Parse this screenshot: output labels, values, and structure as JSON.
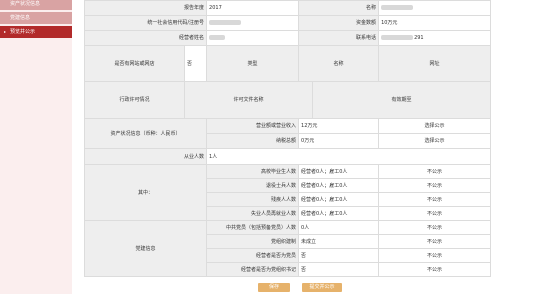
{
  "sidebar": {
    "items": [
      {
        "label": "资产状况信息",
        "active": false
      },
      {
        "label": "党建信息",
        "active": false
      },
      {
        "label": "预览并公示",
        "active": true
      }
    ]
  },
  "info": {
    "report_year_label": "报告年度",
    "report_year_value": "2017",
    "name_label": "名称",
    "credit_code_label": "统一社会信用代码/注册号",
    "capital_label": "资金数额",
    "capital_value": "10万元",
    "operator_label": "经营者姓名",
    "phone_label": "联系电话",
    "phone_value": "291"
  },
  "website": {
    "label": "是否有网站或网店",
    "value": "否",
    "col_type": "类型",
    "col_name": "名称",
    "col_url": "网址"
  },
  "license": {
    "label": "行政许可情况",
    "col_name": "许可文件名称",
    "col_expiry": "有效期至"
  },
  "assets": {
    "label": "资产状况信息（币种：人民币）",
    "rows": [
      {
        "label": "营业额或营业收入",
        "value": "12万元",
        "status": "选择公示"
      },
      {
        "label": "纳税总额",
        "value": "0万元",
        "status": "选择公示"
      }
    ]
  },
  "employees": {
    "label": "从业人数",
    "value": "1人"
  },
  "including": {
    "label": "其中：",
    "rows": [
      {
        "label": "高校毕业生人数",
        "value": "经营者0人；雇工0人",
        "status": "不公示"
      },
      {
        "label": "退役士兵人数",
        "value": "经营者0人；雇工0人",
        "status": "不公示"
      },
      {
        "label": "残疾人人数",
        "value": "经营者0人；雇工0人",
        "status": "不公示"
      },
      {
        "label": "失业人员再就业人数",
        "value": "经营者0人；雇工0人",
        "status": "不公示"
      }
    ]
  },
  "party": {
    "label": "党建信息",
    "rows": [
      {
        "label": "中共党员（包括预备党员）人数",
        "value": "0人",
        "status": "不公示"
      },
      {
        "label": "党组织建制",
        "value": "未成立",
        "status": "不公示"
      },
      {
        "label": "经营者是否为党员",
        "value": "否",
        "status": "不公示"
      },
      {
        "label": "经营者是否为党组织书记",
        "value": "否",
        "status": "不公示"
      }
    ]
  },
  "buttons": {
    "save_label": "保存",
    "submit_label": "提交并公示"
  }
}
